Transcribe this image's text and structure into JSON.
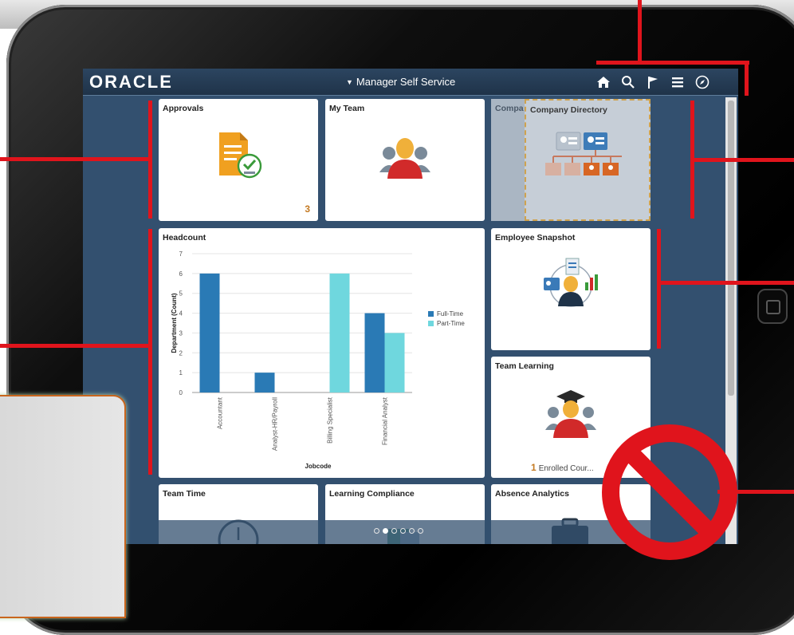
{
  "banner": {
    "brand": "ORACLE",
    "title": "Manager Self Service"
  },
  "icons": {
    "home": "home-icon",
    "search": "search-icon",
    "notifications": "flag-icon",
    "menu": "menu-icon",
    "navbar": "compass-icon"
  },
  "tiles": {
    "approvals": {
      "title": "Approvals",
      "count": "3"
    },
    "my_team": {
      "title": "My Team"
    },
    "company_directory": {
      "title": "Company Directory",
      "ghost_title": "Compa"
    },
    "headcount": {
      "title": "Headcount"
    },
    "employee_snapshot": {
      "title": "Employee Snapshot"
    },
    "team_learning": {
      "title": "Team Learning",
      "count": "1",
      "text": "Enrolled Cour..."
    },
    "team_time": {
      "title": "Team Time"
    },
    "learning_compliance": {
      "title": "Learning Compliance"
    },
    "absence_analytics": {
      "title": "Absence Analytics"
    }
  },
  "pager": {
    "pages": 6,
    "active": 1
  },
  "colors": {
    "banner": "#1f3349",
    "screen": "#33506f",
    "full_time": "#2a7ab5",
    "part_time": "#6fd7de",
    "annotation_red": "#e0141c",
    "accent_orange": "#c47a22"
  },
  "chart_data": {
    "type": "bar",
    "title": "Headcount",
    "xlabel": "Jobcode",
    "ylabel": "Department (Count)",
    "categories": [
      "Accountant",
      "Analyst-HR/Payroll",
      "Billing Specialist",
      "Financial Analyst"
    ],
    "series": [
      {
        "name": "Full-Time",
        "values": [
          6,
          1,
          0,
          4
        ],
        "color": "#2a7ab5"
      },
      {
        "name": "Part-Time",
        "values": [
          0,
          0,
          6,
          3
        ],
        "color": "#6fd7de"
      }
    ],
    "ylim": [
      0,
      7
    ],
    "yticks": [
      "0",
      "1",
      "2",
      "3",
      "4",
      "5",
      "6",
      "7"
    ],
    "grid": true,
    "legend": "right"
  }
}
